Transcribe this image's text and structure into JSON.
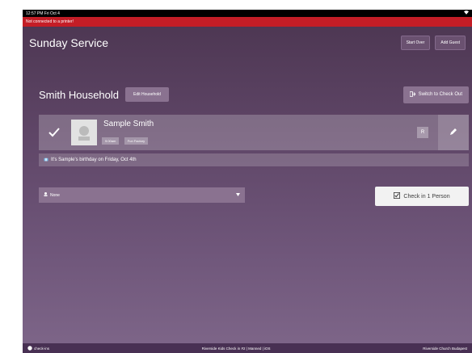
{
  "status_bar": {
    "time": "12:57 PM  Fri Oct 4",
    "wifi": "wifi-icon"
  },
  "banner": {
    "text": "Not connected to a printer!"
  },
  "header": {
    "title": "Sunday Service",
    "start_over": "Start Over",
    "add_guest": "Add Guest"
  },
  "household": {
    "name": "Smith Household",
    "edit_label": "Edit Household",
    "switch_label": "Switch to Check Out"
  },
  "person": {
    "name": "Sample Smith",
    "tags": [
      "9:00am",
      "Fun Factory"
    ],
    "badge": "R"
  },
  "birthday": {
    "text": "It's Sample's birthday on Friday, Oct 4th"
  },
  "select": {
    "value": "None"
  },
  "checkin": {
    "label": "Check in 1 Person"
  },
  "footer": {
    "left": "check-ins",
    "center": "Riverside Kids Check in #2 | Manned | iOS",
    "right": "Riverside Church Budapest"
  },
  "colors": {
    "banner": "#c41d26",
    "background_top": "#4b3550",
    "background_bottom": "#7e6689"
  }
}
